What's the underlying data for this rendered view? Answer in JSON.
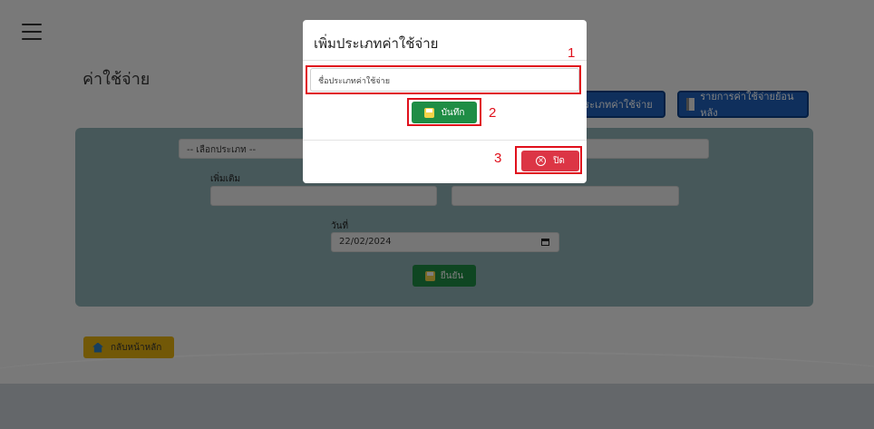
{
  "page": {
    "title": "ค่าใช้จ่าย",
    "top_buttons": {
      "add_category": "มประเภทค่าใช้จ่าย",
      "history": "รายการค่าใช้จ่ายย้อนหลัง"
    },
    "form": {
      "category_select": "-- เลือกประเภท --",
      "more_label": "เพิ่มเติม",
      "date_label": "วันที่",
      "date_value": "22/02/2024",
      "confirm": "ยืนยัน"
    },
    "back_button": "กลับหน้าหลัก"
  },
  "modal": {
    "title": "เพิ่มประเภทค่าใช้จ่าย",
    "input_placeholder": "ชื่อประเภทค่าใช้จ่าย",
    "save": "บันทึก",
    "close": "ปิด"
  },
  "annotations": [
    "1",
    "2",
    "3"
  ],
  "colors": {
    "accent_red": "#e0101c",
    "save_green": "#1f8d45",
    "close_red": "#dc3545",
    "form_teal": "#8fb0b4"
  }
}
